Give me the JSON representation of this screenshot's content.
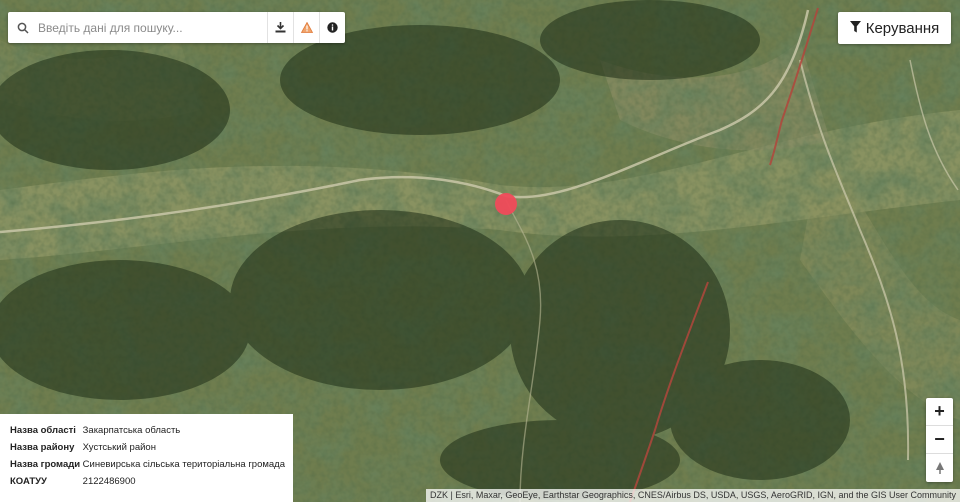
{
  "search": {
    "placeholder": "Введіть дані для пошуку...",
    "search_icon": "search-icon",
    "tools": [
      "download-icon",
      "warning-icon",
      "info-icon"
    ]
  },
  "controls": {
    "label": "Керування",
    "icon": "filter-icon"
  },
  "zoom": {
    "in": "+",
    "out": "−",
    "north": "north-arrow-icon"
  },
  "info_panel": {
    "rows": [
      {
        "key": "Назва області",
        "value": "Закарпатська область"
      },
      {
        "key": "Назва району",
        "value": "Хустський район"
      },
      {
        "key": "Назва громади",
        "value": "Синевирська сільська територіальна громада"
      },
      {
        "key": "КОАТУУ",
        "value": "2122486900"
      }
    ]
  },
  "attribution": "DZK | Esri, Maxar, GeoEye, Earthstar Geographics, CNES/Airbus DS, USDA, USGS, AeroGRID, IGN, and the GIS User Community",
  "colors": {
    "marker": "#f04a5a",
    "road_label": "#c0392b"
  }
}
